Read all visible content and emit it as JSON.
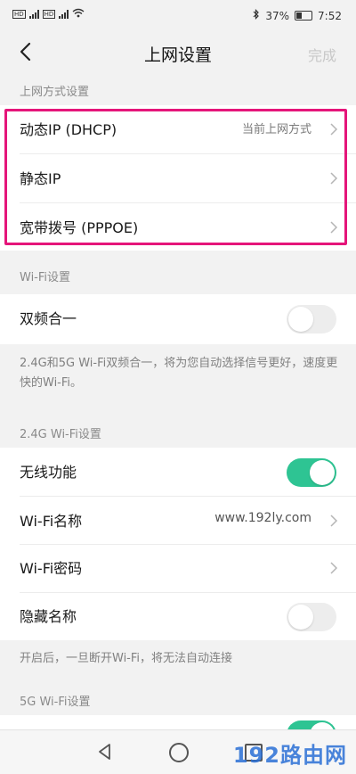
{
  "status": {
    "left_tags": [
      "HD",
      "HD"
    ],
    "network": "4G",
    "battery": "37%",
    "time": "7:52"
  },
  "header": {
    "title": "上网设置",
    "done_label": "完成"
  },
  "wan": {
    "section_label": "上网方式设置",
    "items": [
      {
        "label": "动态IP (DHCP)",
        "value": "当前上网方式"
      },
      {
        "label": "静态IP",
        "value": ""
      },
      {
        "label": "宽带拨号 (PPPOE)",
        "value": ""
      }
    ]
  },
  "wifi": {
    "section_label": "Wi-Fi设置",
    "dual_band_label": "双频合一",
    "dual_band_on": false,
    "dual_band_desc": "2.4G和5G Wi-Fi双频合一，将为您自动选择信号更好，速度更快的Wi-Fi。"
  },
  "wifi24": {
    "section_label": "2.4G Wi-Fi设置",
    "wireless_label": "无线功能",
    "wireless_on": true,
    "ssid_label": "Wi-Fi名称",
    "ssid_value": "www.192ly.com",
    "password_label": "Wi-Fi密码",
    "hide_label": "隐藏名称",
    "hide_on": false,
    "hide_desc": "开启后，一旦断开Wi-Fi，将无法自动连接"
  },
  "wifi5": {
    "section_label": "5G Wi-Fi设置"
  },
  "watermark": "192路由网",
  "colors": {
    "accent": "#2ec493",
    "highlight": "#e5157a",
    "watermark": "#2a6fd6"
  }
}
